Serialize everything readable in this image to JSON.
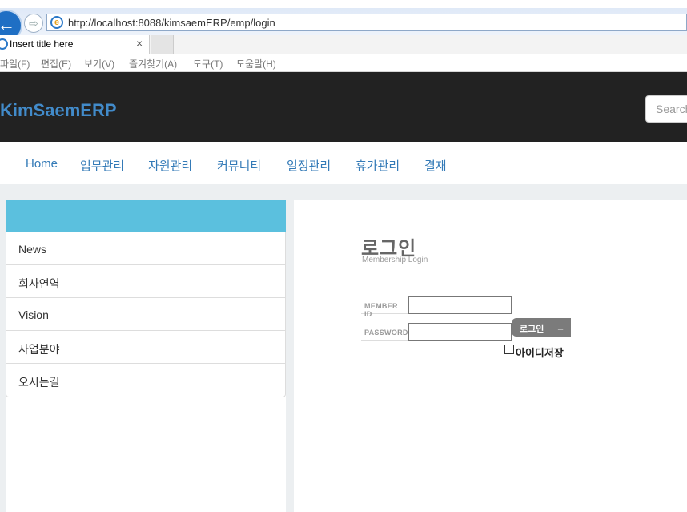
{
  "browser": {
    "url": "http://localhost:8088/kimsaemERP/emp/login",
    "tab_title": "Insert title here",
    "tab_close": "×",
    "back_glyph": "←",
    "fwd_glyph": "⇨",
    "menu": [
      "파일(F)",
      "편집(E)",
      "보기(V)",
      "즐겨찾기(A)",
      "도구(T)",
      "도움말(H)"
    ]
  },
  "navbar": {
    "brand": "KimSaemERP",
    "search_placeholder": "Search"
  },
  "nav": {
    "links": [
      "Home",
      "업무관리",
      "자원관리",
      "커뮤니티",
      "일정관리",
      "휴가관리",
      "결재"
    ]
  },
  "sidebar": {
    "items": [
      {
        "label": "News"
      },
      {
        "label": "회사연역"
      },
      {
        "label": "Vision"
      },
      {
        "label": "사업분야"
      },
      {
        "label": "오시는길"
      }
    ]
  },
  "login": {
    "title": "로그인",
    "subtitle": "Membership Login",
    "member_id_label": "MEMBER ID",
    "password_label": "PASSWORD",
    "button_label": "로그인",
    "button_glyph": "_",
    "remember_label": "아이디저장"
  },
  "colors": {
    "navbar_bg": "#222222",
    "brand": "#428bca",
    "link": "#337ab7",
    "sidebar_header": "#5bc0de",
    "login_button": "#7b7b7b"
  }
}
